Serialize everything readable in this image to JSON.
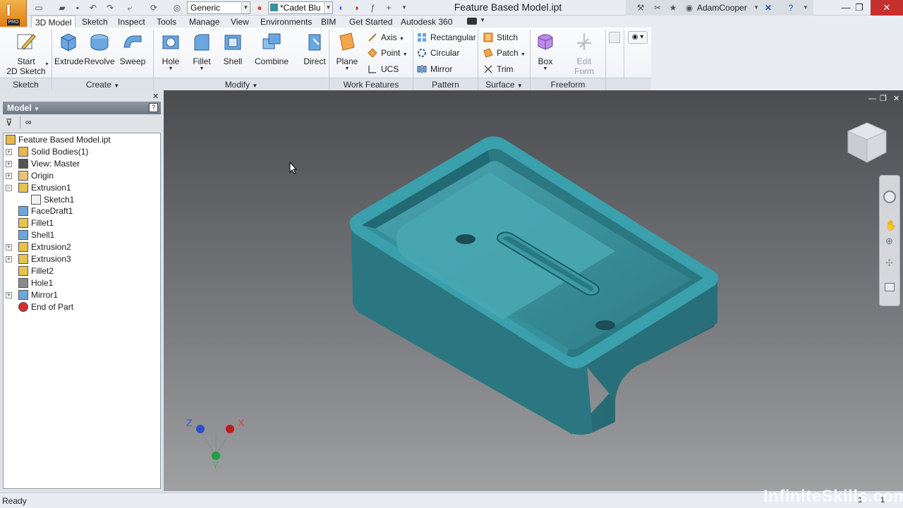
{
  "app": {
    "badge": "PRO",
    "document_title": "Feature Based Model.ipt"
  },
  "quick_access": {
    "material": "Generic",
    "appearance": "*Cadet Blu"
  },
  "user": {
    "name": "AdamCooper"
  },
  "tabs": [
    {
      "label": "3D Model",
      "active": true
    },
    {
      "label": "Sketch"
    },
    {
      "label": "Inspect"
    },
    {
      "label": "Tools"
    },
    {
      "label": "Manage"
    },
    {
      "label": "View"
    },
    {
      "label": "Environments"
    },
    {
      "label": "BIM"
    },
    {
      "label": "Get Started"
    },
    {
      "label": "Autodesk 360"
    }
  ],
  "ribbon": {
    "sketch": {
      "panel": "Sketch",
      "start_line1": "Start",
      "start_line2": "2D Sketch"
    },
    "create": {
      "panel": "Create",
      "extrude": "Extrude",
      "revolve": "Revolve",
      "sweep": "Sweep"
    },
    "modify": {
      "panel": "Modify",
      "hole": "Hole",
      "fillet": "Fillet",
      "shell": "Shell",
      "combine": "Combine",
      "direct": "Direct"
    },
    "work_features": {
      "panel": "Work Features",
      "plane": "Plane",
      "axis": "Axis",
      "point": "Point",
      "ucs": "UCS"
    },
    "pattern": {
      "panel": "Pattern",
      "rectangular": "Rectangular",
      "circular": "Circular",
      "mirror": "Mirror"
    },
    "surface": {
      "panel": "Surface",
      "stitch": "Stitch",
      "patch": "Patch",
      "trim": "Trim"
    },
    "freeform": {
      "panel": "Freeform",
      "box": "Box",
      "edit_form_line1": "Edit",
      "edit_form_line2": "Form"
    }
  },
  "browser": {
    "title": "Model",
    "tree": [
      {
        "label": "Feature Based Model.ipt",
        "icon": "part-icon",
        "level": 0
      },
      {
        "label": "Solid Bodies(1)",
        "icon": "solid-bodies-icon",
        "level": 1,
        "expander": true
      },
      {
        "label": "View: Master",
        "icon": "view-icon",
        "level": 1,
        "expander": true
      },
      {
        "label": "Origin",
        "icon": "folder-icon",
        "level": 1,
        "expander": true
      },
      {
        "label": "Extrusion1",
        "icon": "extrusion-icon",
        "level": 1,
        "expander": true,
        "expanded": true
      },
      {
        "label": "Sketch1",
        "icon": "sketch-icon",
        "level": 2
      },
      {
        "label": "FaceDraft1",
        "icon": "face-draft-icon",
        "level": 1
      },
      {
        "label": "Fillet1",
        "icon": "fillet-icon",
        "level": 1
      },
      {
        "label": "Shell1",
        "icon": "shell-icon",
        "level": 1
      },
      {
        "label": "Extrusion2",
        "icon": "extrusion-icon",
        "level": 1,
        "expander": true
      },
      {
        "label": "Extrusion3",
        "icon": "extrusion-icon",
        "level": 1,
        "expander": true
      },
      {
        "label": "Fillet2",
        "icon": "fillet-icon",
        "level": 1
      },
      {
        "label": "Hole1",
        "icon": "hole-icon",
        "level": 1
      },
      {
        "label": "Mirror1",
        "icon": "mirror-icon",
        "level": 1,
        "expander": true
      },
      {
        "label": "End of Part",
        "icon": "end-of-part-icon",
        "level": 1
      }
    ]
  },
  "viewport": {
    "model_color": "#3a8f9b",
    "triad": {
      "x": "X",
      "y": "Y",
      "z": "Z"
    }
  },
  "status": {
    "text": "Ready",
    "watermark": "InfiniteSkills.com"
  }
}
